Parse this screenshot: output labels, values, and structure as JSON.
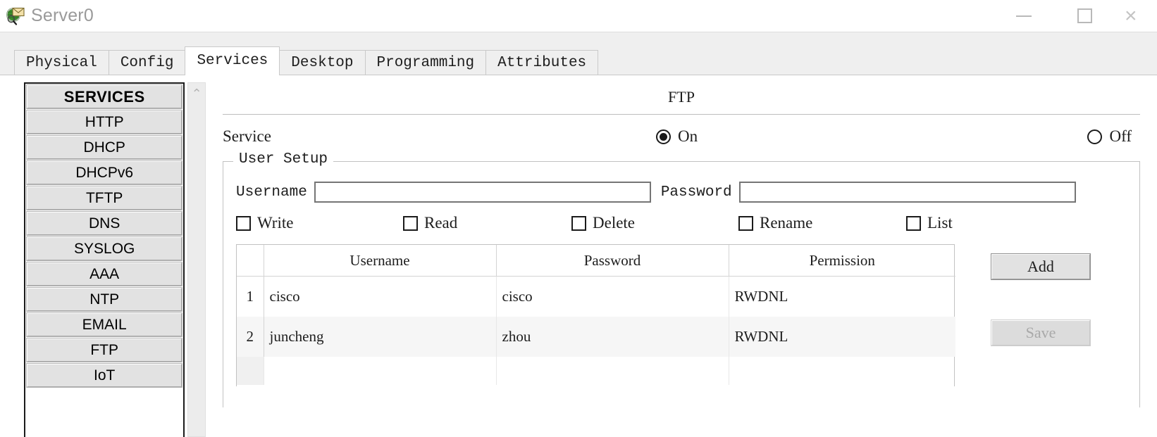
{
  "window": {
    "title": "Server0",
    "icon": "server-device-icon",
    "controls": {
      "minimize": "—",
      "maximize": "□",
      "close": "×"
    }
  },
  "tabs": [
    {
      "label": "Physical",
      "active": false
    },
    {
      "label": "Config",
      "active": false
    },
    {
      "label": "Services",
      "active": true
    },
    {
      "label": "Desktop",
      "active": false
    },
    {
      "label": "Programming",
      "active": false
    },
    {
      "label": "Attributes",
      "active": false
    }
  ],
  "sidebar": {
    "header": "SERVICES",
    "items": [
      {
        "label": "HTTP"
      },
      {
        "label": "DHCP"
      },
      {
        "label": "DHCPv6"
      },
      {
        "label": "TFTP"
      },
      {
        "label": "DNS"
      },
      {
        "label": "SYSLOG"
      },
      {
        "label": "AAA"
      },
      {
        "label": "NTP"
      },
      {
        "label": "EMAIL"
      },
      {
        "label": "FTP"
      },
      {
        "label": "IoT"
      }
    ],
    "scroll_up_glyph": "⌃"
  },
  "panel": {
    "title": "FTP",
    "service": {
      "label": "Service",
      "on_label": "On",
      "off_label": "Off",
      "selected": "On"
    },
    "user_setup": {
      "legend": "User Setup",
      "username_label": "Username",
      "username_value": "",
      "username_placeholder": "",
      "password_label": "Password",
      "password_value": "",
      "password_placeholder": "",
      "permissions": [
        {
          "label": "Write",
          "checked": false
        },
        {
          "label": "Read",
          "checked": false
        },
        {
          "label": "Delete",
          "checked": false
        },
        {
          "label": "Rename",
          "checked": false
        },
        {
          "label": "List",
          "checked": false
        }
      ],
      "table": {
        "columns": [
          "Username",
          "Password",
          "Permission"
        ],
        "rows": [
          {
            "index": "1",
            "username": "cisco",
            "password": "cisco",
            "permission": "RWDNL"
          },
          {
            "index": "2",
            "username": "juncheng",
            "password": "zhou",
            "permission": "RWDNL"
          }
        ]
      },
      "add_label": "Add",
      "save_label": "Save",
      "save_disabled": true
    }
  },
  "colors": {
    "button_face": "#e2e2e2",
    "tab_strip": "#efefef",
    "title_text": "#9a9a9a",
    "alt_row": "#f6f6f6",
    "disabled_text": "#a9a9a9"
  }
}
